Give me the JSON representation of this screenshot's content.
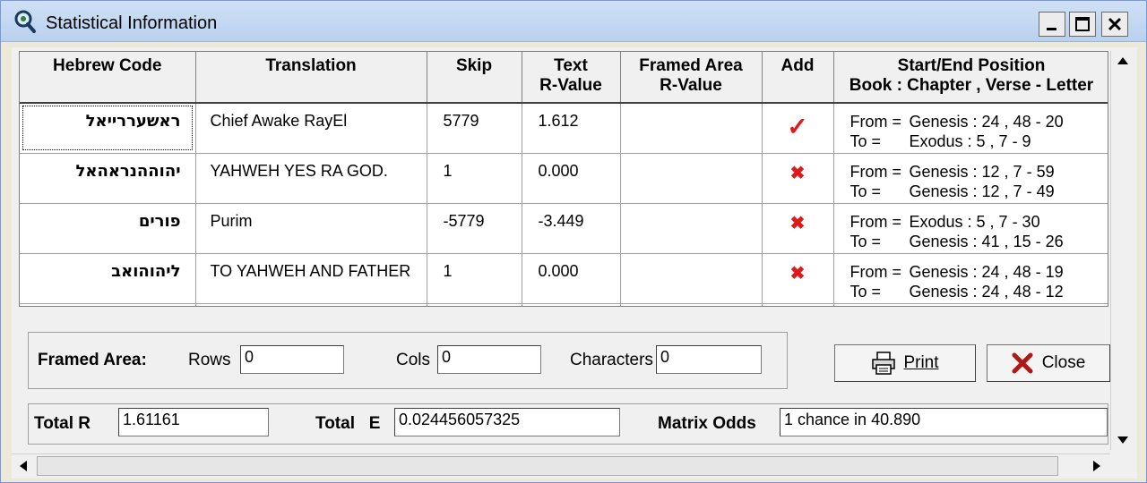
{
  "window": {
    "title": "Statistical Information"
  },
  "columns": [
    {
      "line1": "Hebrew Code",
      "line2": ""
    },
    {
      "line1": "Translation",
      "line2": ""
    },
    {
      "line1": "Skip",
      "line2": ""
    },
    {
      "line1": "Text",
      "line2": "R-Value"
    },
    {
      "line1": "Framed Area",
      "line2": "R-Value"
    },
    {
      "line1": "Add",
      "line2": ""
    },
    {
      "line1": "Start/End Position",
      "line2": "Book : Chapter , Verse - Letter"
    }
  ],
  "rows": [
    {
      "hebrew": "ראשעררייאל",
      "translation": "Chief Awake RayEl",
      "skip": "5779",
      "text_r": "1.612",
      "framed_r": "",
      "add": "check",
      "from_label": "From =",
      "from": "Genesis : 24 , 48 - 20",
      "to_label": "To =",
      "to": "Exodus : 5 , 7 - 9"
    },
    {
      "hebrew": "יהוההנראהאל",
      "translation": "YAHWEH YES RA GOD.",
      "skip": "1",
      "text_r": "0.000",
      "framed_r": "",
      "add": "x",
      "from_label": "From =",
      "from": "Genesis : 12 , 7 - 59",
      "to_label": "To =",
      "to": "Genesis : 12 , 7 - 49"
    },
    {
      "hebrew": "פורים",
      "translation": "Purim",
      "skip": "-5779",
      "text_r": "-3.449",
      "framed_r": "",
      "add": "x",
      "from_label": "From =",
      "from": "Exodus : 5 , 7 - 30",
      "to_label": "To =",
      "to": "Genesis : 41 , 15 - 26"
    },
    {
      "hebrew": "ליהוהואב",
      "translation": "TO YAHWEH AND FATHER",
      "skip": "1",
      "text_r": "0.000",
      "framed_r": "",
      "add": "x",
      "from_label": "From =",
      "from": "Genesis : 24 , 48 - 19",
      "to_label": "To =",
      "to": "Genesis : 24 , 48 - 12"
    }
  ],
  "framed_area": {
    "label": "Framed Area:",
    "rows_label": "Rows",
    "rows_value": "0",
    "cols_label": "Cols",
    "cols_value": "0",
    "chars_label": "Characters",
    "chars_value": "0"
  },
  "buttons": {
    "print": "Print",
    "close": "Close"
  },
  "totals": {
    "total_r_label": "Total R",
    "total_r_value": "1.61161",
    "total_e_label": "Total   E",
    "total_e_value": "0.024456057325",
    "odds_label": "Matrix Odds",
    "odds_value": "1 chance in 40.890"
  },
  "colors": {
    "mark": "#e01a1a",
    "titlebar": "#b9d1ee"
  },
  "icons": [
    "search-icon",
    "minimize-icon",
    "maximize-icon",
    "close-icon",
    "printer-icon",
    "close-x-icon"
  ]
}
